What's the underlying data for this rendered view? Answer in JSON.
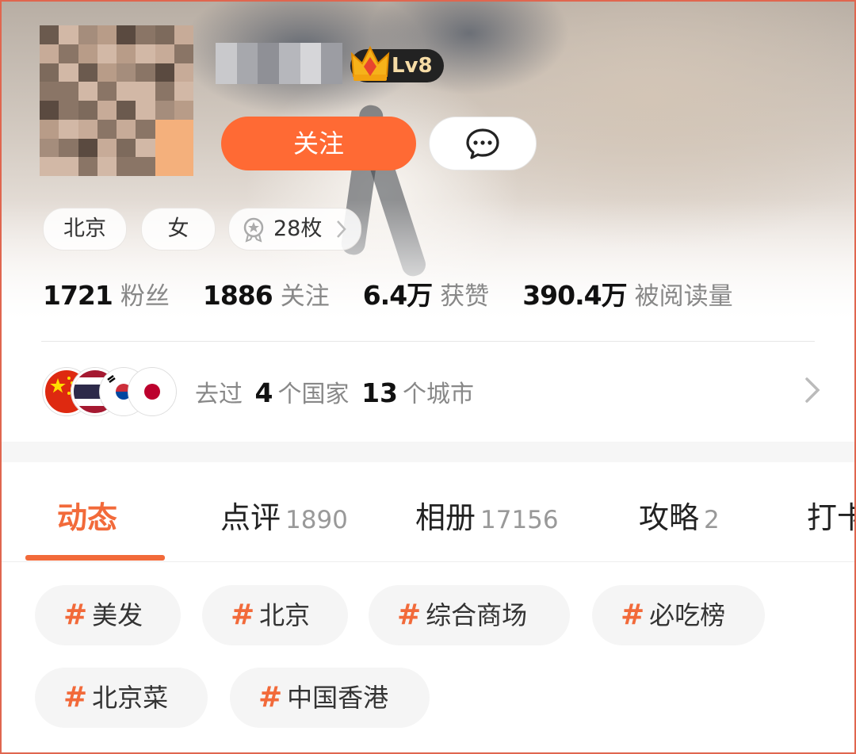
{
  "profile": {
    "level": "Lv8",
    "follow_label": "关注",
    "chips": {
      "city": "北京",
      "gender": "女",
      "badges": "28枚"
    }
  },
  "stats": [
    {
      "value": "1721",
      "label": "粉丝"
    },
    {
      "value": "1886",
      "label": "关注"
    },
    {
      "value": "6.4万",
      "label": "获赞"
    },
    {
      "value": "390.4万",
      "label": "被阅读量"
    }
  ],
  "travel": {
    "prefix": "去过",
    "countries": "4",
    "country_unit": "个国家",
    "cities": "13",
    "city_unit": "个城市",
    "flags": [
      "china-flag",
      "thailand-flag",
      "korea-flag",
      "japan-flag"
    ]
  },
  "tabs": [
    {
      "label": "动态",
      "count": "",
      "active": true
    },
    {
      "label": "点评",
      "count": "1890"
    },
    {
      "label": "相册",
      "count": "17156"
    },
    {
      "label": "攻略",
      "count": "2"
    },
    {
      "label": "打卡",
      "count": ""
    }
  ],
  "topics": {
    "hash": "#",
    "items": [
      "美发",
      "北京",
      "综合商场",
      "必吃榜",
      "北京菜",
      "中国香港"
    ]
  },
  "colors": {
    "accent": "#ff6a34",
    "tab_active": "#f26a3a",
    "level_badge_bg": "#222222",
    "border": "#e0664f"
  }
}
